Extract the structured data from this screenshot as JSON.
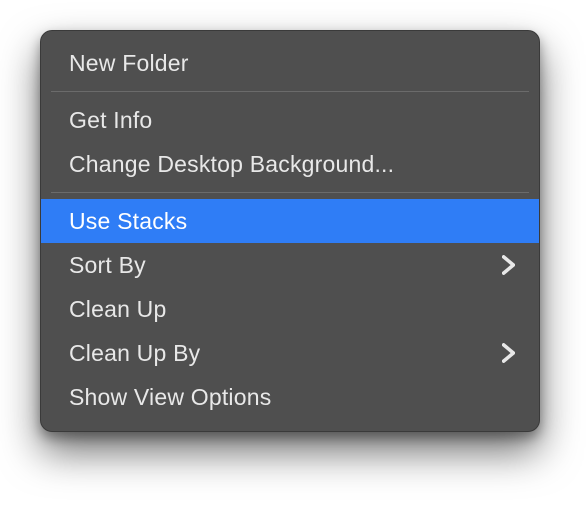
{
  "menu": {
    "highlighted": "use-stacks",
    "highlight_color": "#2f7df6",
    "background_color": "#4f4f4f",
    "text_color": "#e8e8e8",
    "groups": [
      {
        "items": [
          {
            "id": "new-folder",
            "label": "New Folder",
            "submenu": false
          }
        ]
      },
      {
        "items": [
          {
            "id": "get-info",
            "label": "Get Info",
            "submenu": false
          },
          {
            "id": "change-desktop-background",
            "label": "Change Desktop Background...",
            "submenu": false
          }
        ]
      },
      {
        "items": [
          {
            "id": "use-stacks",
            "label": "Use Stacks",
            "submenu": false,
            "highlighted": true
          },
          {
            "id": "sort-by",
            "label": "Sort By",
            "submenu": true
          },
          {
            "id": "clean-up",
            "label": "Clean Up",
            "submenu": false
          },
          {
            "id": "clean-up-by",
            "label": "Clean Up By",
            "submenu": true
          },
          {
            "id": "show-view-options",
            "label": "Show View Options",
            "submenu": false
          }
        ]
      }
    ]
  }
}
